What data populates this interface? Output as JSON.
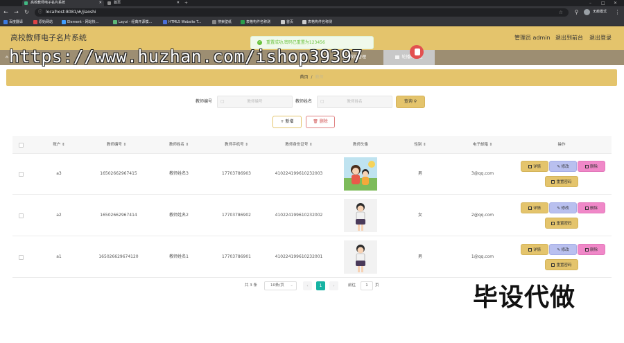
{
  "browser": {
    "tabs": [
      {
        "title": "高校教师电子名片系统",
        "active": true
      },
      {
        "title": "首页",
        "active": false
      }
    ],
    "url": "localhost:8081/#/jiaoshi",
    "profile_label": "无痕模式",
    "bookmarks": [
      "百度翻译",
      "原始网站",
      "Element - 网站快...",
      "Layui - 经典开源模...",
      "HTML5 Website T...",
      "搜索壁纸",
      "表格构件名称测",
      "首页",
      "表格构件名称测"
    ]
  },
  "header": {
    "title": "高校教师电子名片系统",
    "admin_label": "管理员 admin",
    "front_link": "退出到前台",
    "logout_link": "退出登录"
  },
  "menu": {
    "items": [
      "教师管理",
      "轮播图管理"
    ]
  },
  "toast": {
    "message": "重置成功,密码已重置为123456"
  },
  "watermark": "https://www.huzhan.com/ishop39397",
  "breadcrumb": {
    "home": "首页",
    "separator": "/",
    "current": "教师"
  },
  "search": {
    "fields": [
      {
        "label": "教师编号",
        "placeholder": "教师编号"
      },
      {
        "label": "教师姓名",
        "placeholder": "教师姓名"
      }
    ],
    "query_button": "查询"
  },
  "actions": {
    "add_button": "新增",
    "delete_button": "删除"
  },
  "table": {
    "columns": [
      "账户",
      "教师编号",
      "教师姓名",
      "教师手机号",
      "教师身份证号",
      "教师头像",
      "性别",
      "电子邮箱",
      "操作"
    ],
    "rows": [
      {
        "account": "a3",
        "number": "16502662967415",
        "name": "教师姓名3",
        "phone": "17703786903",
        "id_card": "410224199610232003",
        "gender": "男",
        "email": "3@qq.com"
      },
      {
        "account": "a2",
        "number": "16502662967414",
        "name": "教师姓名2",
        "phone": "17703786902",
        "id_card": "410224199610232002",
        "gender": "女",
        "email": "2@qq.com"
      },
      {
        "account": "a1",
        "number": "165026629674120",
        "name": "教师姓名1",
        "phone": "17703786901",
        "id_card": "410224199610232001",
        "gender": "男",
        "email": "1@qq.com"
      }
    ],
    "row_buttons": {
      "detail": "详情",
      "edit": "修改",
      "delete": "删除",
      "reset": "重置密码"
    }
  },
  "pagination": {
    "total_label": "共 3 条",
    "page_size": "10条/页",
    "current_page": "1",
    "goto_label": "前往",
    "goto_value": "1",
    "page_suffix": "页"
  },
  "overlay_text": "毕设代做",
  "colors": {
    "header": "#e4c46c",
    "menu": "#9d8e72",
    "page_active": "#17b3a3",
    "edit": "#b9c0ef",
    "delete": "#f088c8",
    "toast": "#67c23a"
  }
}
